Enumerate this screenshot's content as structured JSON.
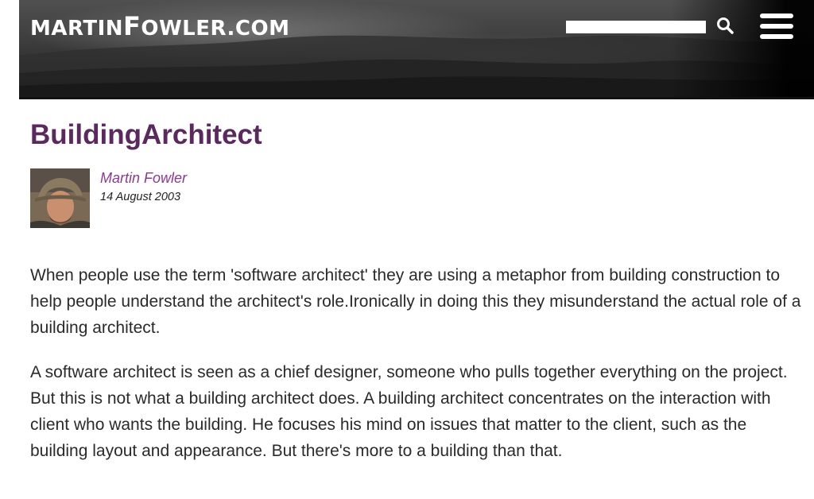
{
  "header": {
    "logo_text_1": "MARTIN",
    "logo_text_2": "F",
    "logo_text_3": "OWLER.COM",
    "search_value": "",
    "search_icon": "search-icon",
    "menu_icon": "hamburger-menu-icon"
  },
  "article": {
    "title": "BuildingArchitect",
    "author": "Martin Fowler",
    "date": "14 August 2003",
    "paragraphs": [
      "When people use the term 'software architect' they are using a metaphor from building construction to help people understand the architect's role.Ironically in doing this they misunderstand the actual role of a building architect.",
      "A software architect is seen as a chief designer, someone who pulls together everything on the project. But this is not what a building architect does. A building architect concentrates on the interaction with client who wants the building. He focuses his mind on issues that matter to the client, such as the building layout and appearance. But there's more to a building than that."
    ]
  },
  "colors": {
    "title": "#5a2a5e",
    "author_link": "#8a3a8e",
    "header_bg": "#3c3c3c"
  }
}
